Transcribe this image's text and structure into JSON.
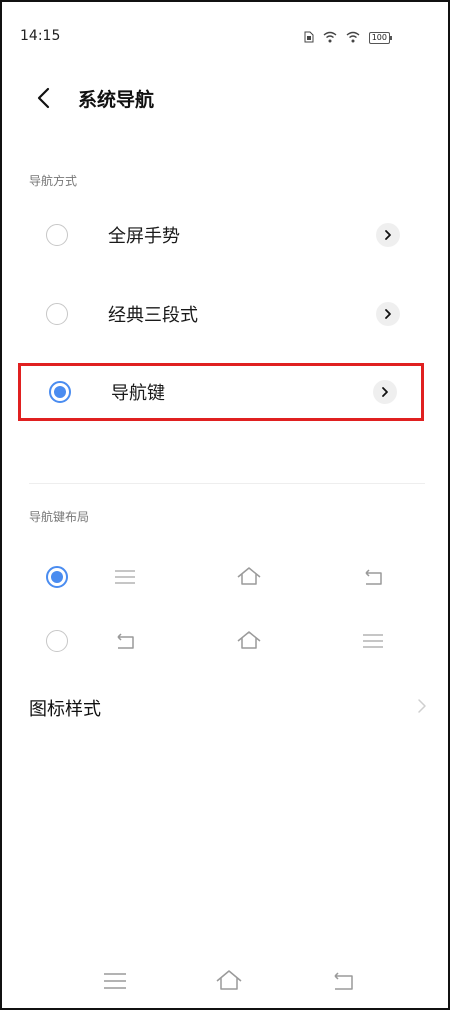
{
  "status_bar": {
    "time": "14:15",
    "battery": "100",
    "icons": [
      "sim-card-icon",
      "wifi-icon",
      "wifi-icon",
      "battery-icon"
    ]
  },
  "header": {
    "title": "系统导航"
  },
  "nav_mode": {
    "section_label": "导航方式",
    "options": [
      {
        "label": "全屏手势",
        "selected": false
      },
      {
        "label": "经典三段式",
        "selected": false
      },
      {
        "label": "导航键",
        "selected": true,
        "highlighted": true
      }
    ]
  },
  "key_layout": {
    "section_label": "导航键布局",
    "rows": [
      {
        "selected": true,
        "keys": [
          "menu-icon",
          "home-icon",
          "back-icon"
        ]
      },
      {
        "selected": false,
        "keys": [
          "back-icon",
          "home-icon",
          "menu-icon"
        ]
      }
    ]
  },
  "icon_style": {
    "label": "图标样式"
  },
  "bottom_nav": {
    "keys": [
      "menu-icon",
      "home-icon",
      "back-icon"
    ]
  },
  "colors": {
    "accent": "#4a8cf0",
    "highlight_border": "#e02020",
    "muted_text": "#777777",
    "icon_gray": "#b3b3b3"
  }
}
